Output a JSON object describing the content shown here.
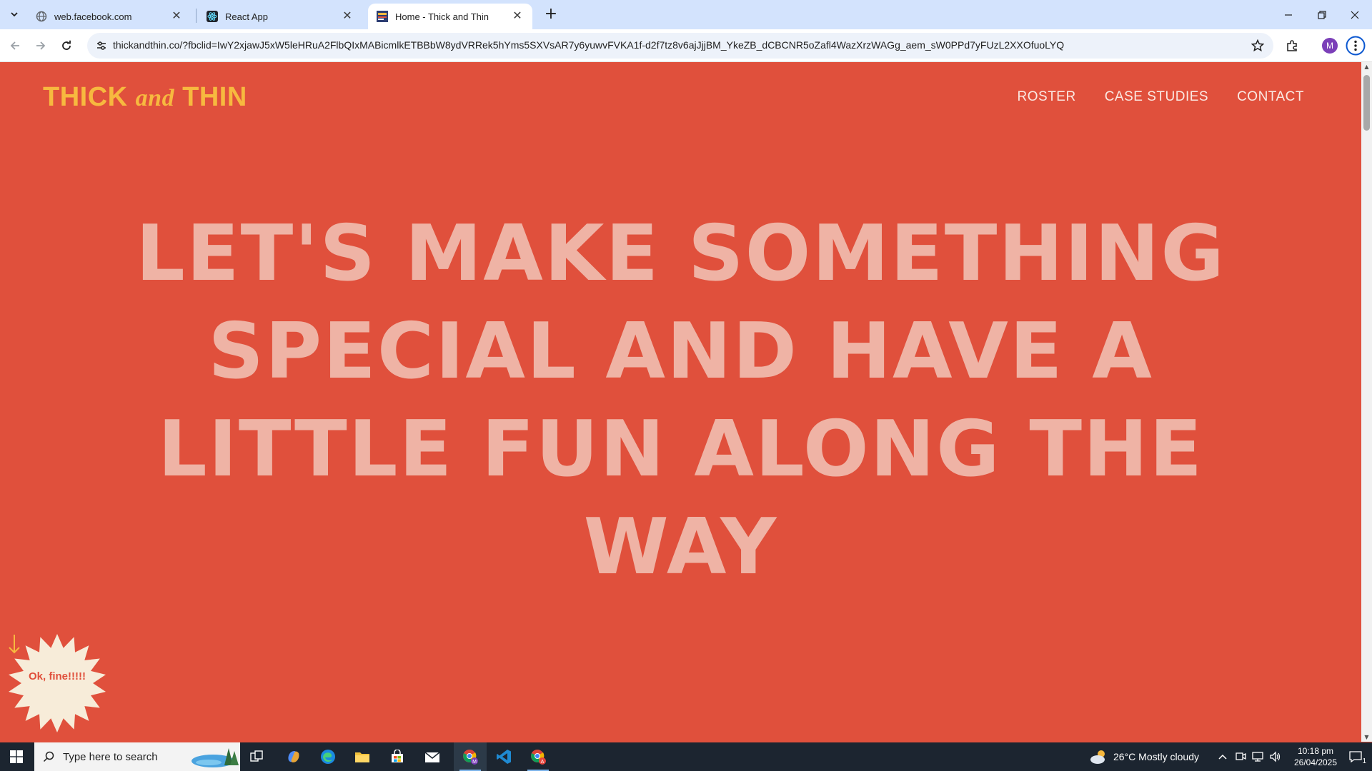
{
  "browser": {
    "tabs": [
      {
        "title": "web.facebook.com",
        "icon": "globe-icon"
      },
      {
        "title": "React App",
        "icon": "react-icon"
      },
      {
        "title": "Home - Thick and Thin",
        "icon": "site-favicon"
      }
    ],
    "active_tab": 2,
    "url": "thickandthin.co/?fbclid=IwY2xjawJ5xW5leHRuA2FlbQIxMABicmlkETBBbW8ydVRRek5hYms5SXVsAR7y6yuwvFVKA1f-d2f7tz8v6ajJjjBM_YkeZB_dCBCNR5oZafl4WazXrzWAGg_aem_sW0PPd7yFUzL2XXOfuoLYQ",
    "profile_initial": "M"
  },
  "site": {
    "logo": {
      "thick": "THICK",
      "and": "and",
      "thin": "THIN"
    },
    "nav": [
      "ROSTER",
      "CASE STUDIES",
      "CONTACT"
    ],
    "hero": "LET'S MAKE SOMETHING SPECIAL AND HAVE A LITTLE FUN ALONG THE WAY",
    "burst_label": "Ok, fine!!!!!",
    "colors": {
      "background": "#e0503c",
      "logo": "#f7b93f",
      "hero_text": "#efb3a5",
      "burst": "#f7ecd9"
    }
  },
  "taskbar": {
    "search_placeholder": "Type here to search",
    "weather": "26°C  Mostly cloudy",
    "time": "10:18 pm",
    "date": "26/04/2025",
    "notification_count": "1"
  }
}
